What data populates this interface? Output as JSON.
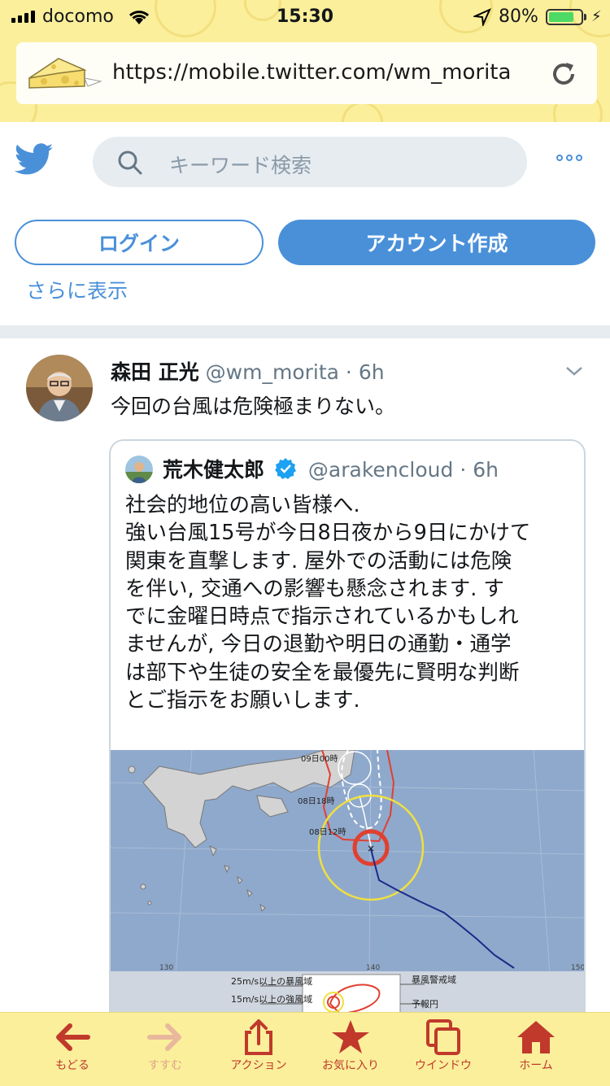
{
  "status_bar": {
    "carrier": "docomo",
    "time": "15:30",
    "battery_percent": "80%",
    "battery_level": 0.8
  },
  "browser": {
    "url": "https://mobile.twitter.com/wm_morita"
  },
  "twitter": {
    "search_placeholder": "キーワード検索",
    "login_label": "ログイン",
    "signup_label": "アカウント作成",
    "show_more": "さらに表示"
  },
  "tweet": {
    "author_name": "森田 正光",
    "author_handle": "@wm_morita",
    "separator": "·",
    "time": "6h",
    "text": "今回の台風は危険極まりない。",
    "quoted": {
      "author_name": "荒木健太郎",
      "author_handle": "@arakencloud",
      "separator": "·",
      "time": "6h",
      "lines": [
        "社会的地位の高い皆様へ.",
        "強い台風15号が今日8日夜から9日にかけて",
        "関東を直撃します. 屋外での活動には危険",
        "を伴い, 交通への影響も懸念されます. す",
        "でに金曜日時点で指示されているかもしれ",
        "ませんが, 今日の退勤や明日の通勤・通学",
        "は部下や生徒の安全を最優先に賢明な判断",
        "とご指示をお願いします."
      ],
      "map": {
        "labels": [
          "09日00時",
          "08日18時",
          "08日12時"
        ],
        "axis_ticks": [
          "130",
          "140",
          "150"
        ],
        "legend": [
          "25m/s以上の暴風域",
          "15m/s以上の強風域",
          "暴風警戒域",
          "予報円"
        ]
      }
    }
  },
  "toolbar": {
    "back": "もどる",
    "forward": "すすむ",
    "action": "アクション",
    "favorites": "お気に入り",
    "windows": "ウインドウ",
    "home": "ホーム"
  },
  "colors": {
    "twitter_blue": "#4a90d9",
    "chrome_yellow": "#fbef9b",
    "toolbar_red": "#c0392b"
  }
}
